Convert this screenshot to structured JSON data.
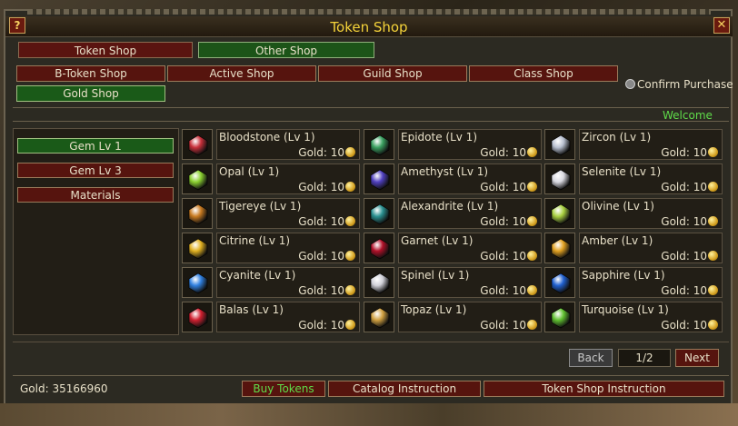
{
  "window": {
    "title": "Token Shop",
    "help_label": "?",
    "close_label": "✕"
  },
  "tabs": [
    {
      "label": "Token Shop",
      "active": false
    },
    {
      "label": "Other Shop",
      "active": true
    }
  ],
  "subshops": [
    "B-Token Shop",
    "Active Shop",
    "Guild Shop",
    "Class Shop",
    "Gold Shop"
  ],
  "confirm_purchase_label": "Confirm Purchase",
  "welcome_text": "Welcome",
  "categories": [
    {
      "label": "Gem Lv 1",
      "active": true
    },
    {
      "label": "Gem Lv 3",
      "active": false
    },
    {
      "label": "Materials",
      "active": false
    }
  ],
  "items": [
    {
      "name": "Bloodstone (Lv 1)",
      "price": "Gold: 10",
      "icon": "bloodstone-icon",
      "color": "#c8303a"
    },
    {
      "name": "Epidote (Lv 1)",
      "price": "Gold: 10",
      "icon": "epidote-icon",
      "color": "#3aa060"
    },
    {
      "name": "Zircon (Lv 1)",
      "price": "Gold: 10",
      "icon": "zircon-icon",
      "color": "#b8c0d0"
    },
    {
      "name": "Opal (Lv 1)",
      "price": "Gold: 10",
      "icon": "opal-icon",
      "color": "#8ad030"
    },
    {
      "name": "Amethyst (Lv 1)",
      "price": "Gold: 10",
      "icon": "amethyst-icon",
      "color": "#5040c0"
    },
    {
      "name": "Selenite (Lv 1)",
      "price": "Gold: 10",
      "icon": "selenite-icon",
      "color": "#d8d8e0"
    },
    {
      "name": "Tigereye (Lv 1)",
      "price": "Gold: 10",
      "icon": "tigereye-icon",
      "color": "#c87a20"
    },
    {
      "name": "Alexandrite (Lv 1)",
      "price": "Gold: 10",
      "icon": "alexandrite-icon",
      "color": "#2a9090"
    },
    {
      "name": "Olivine (Lv 1)",
      "price": "Gold: 10",
      "icon": "olivine-icon",
      "color": "#a8d040"
    },
    {
      "name": "Citrine (Lv 1)",
      "price": "Gold: 10",
      "icon": "citrine-icon",
      "color": "#e0b020"
    },
    {
      "name": "Garnet (Lv 1)",
      "price": "Gold: 10",
      "icon": "garnet-icon",
      "color": "#b01028"
    },
    {
      "name": "Amber (Lv 1)",
      "price": "Gold: 10",
      "icon": "amber-icon",
      "color": "#e0a020"
    },
    {
      "name": "Cyanite (Lv 1)",
      "price": "Gold: 10",
      "icon": "cyanite-icon",
      "color": "#3080e0"
    },
    {
      "name": "Spinel (Lv 1)",
      "price": "Gold: 10",
      "icon": "spinel-icon",
      "color": "#d0d0d8"
    },
    {
      "name": "Sapphire (Lv 1)",
      "price": "Gold: 10",
      "icon": "sapphire-icon",
      "color": "#2060d0"
    },
    {
      "name": "Balas (Lv 1)",
      "price": "Gold: 10",
      "icon": "balas-icon",
      "color": "#d02030"
    },
    {
      "name": "Topaz (Lv 1)",
      "price": "Gold: 10",
      "icon": "topaz-icon",
      "color": "#d0a040"
    },
    {
      "name": "Turquoise (Lv 1)",
      "price": "Gold: 10",
      "icon": "turquoise-icon",
      "color": "#60c030"
    }
  ],
  "pager": {
    "back": "Back",
    "page": "1/2",
    "next": "Next"
  },
  "gold_text": "Gold: 35166960",
  "bottom_buttons": [
    "Buy Tokens",
    "Catalog Instruction",
    "Token Shop Instruction"
  ]
}
